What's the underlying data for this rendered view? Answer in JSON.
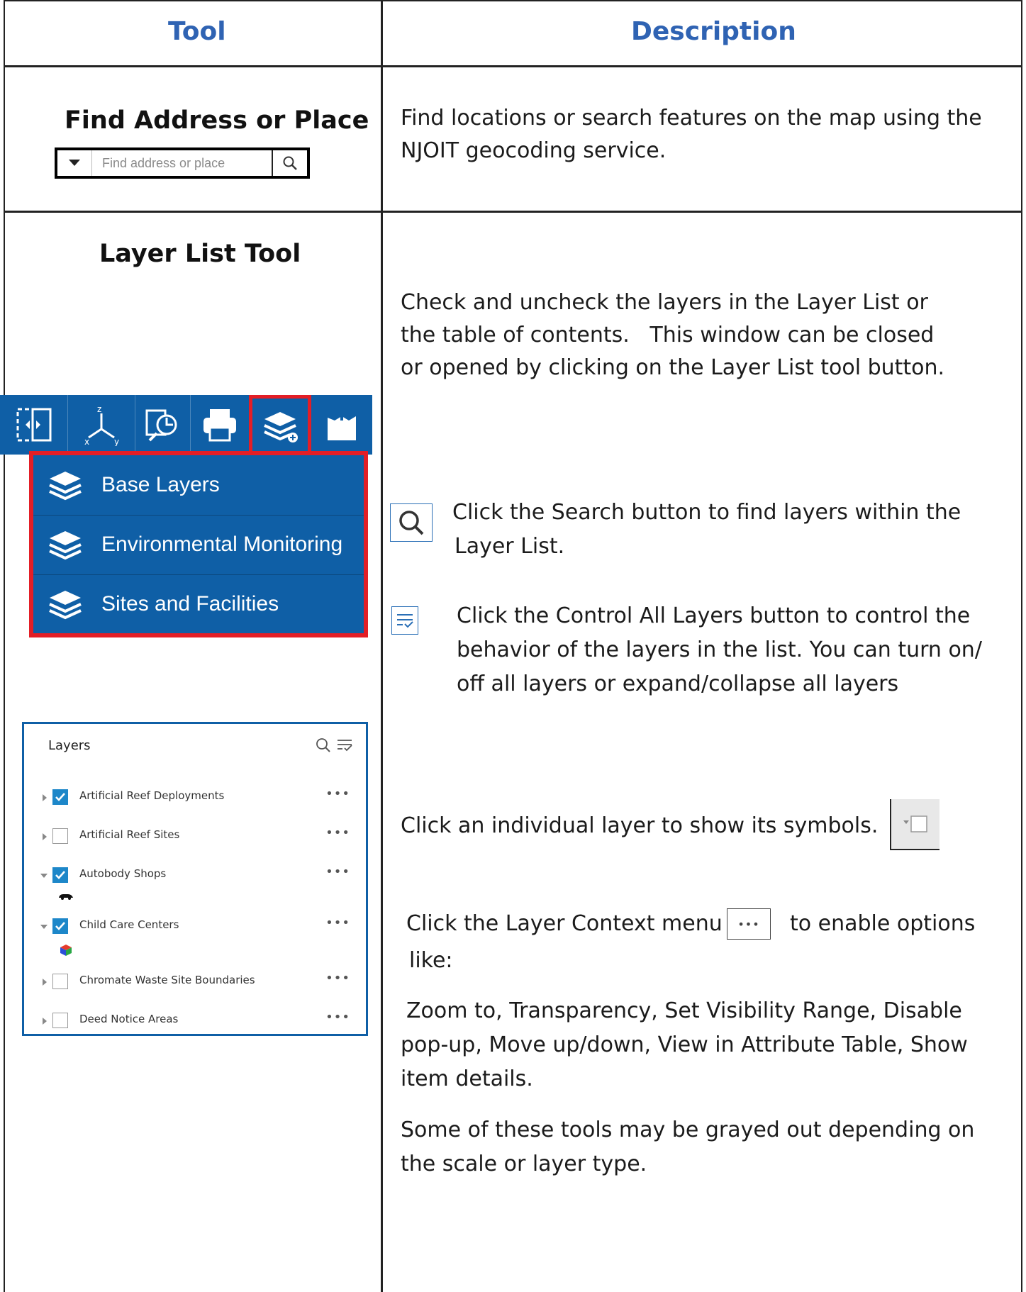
{
  "header": {
    "tool": "Tool",
    "description": "Description"
  },
  "find": {
    "title": "Find Address or Place",
    "placeholder": "Find address or place",
    "description": "Find locations or search features on the map using the NJOIT geocoding service."
  },
  "layerlist": {
    "title": "Layer List Tool",
    "intro": [
      "Check and uncheck the layers in the Layer List or",
      "the table of contents.   This window can be closed",
      "or opened by clicking on the Layer List tool button."
    ],
    "menu_items": [
      "Base Layers",
      "Environmental Monitoring",
      "Sites and Facilities"
    ],
    "search_text": [
      "Click the Search button  to find layers within the",
      "Layer List."
    ],
    "control_text": [
      "Click the Control All Layers button  to control the",
      "behavior of the layers in the list. You can turn on/",
      "off all layers or expand/collapse all layers"
    ],
    "individual_text": "Click an individual layer to show its symbols.",
    "context_text_a": "Click the Layer Context menu",
    "context_text_b": "to enable options",
    "context_text_c": "like:",
    "options_text": [
      "Zoom to, Transparency, Set Visibility Range, Disable",
      "pop-up, Move up/down, View in Attribute Table, Show",
      "item details."
    ],
    "grayed_text": [
      "Some of these tools may be grayed out depending on",
      "the scale or layer type."
    ]
  },
  "panel": {
    "title": "Layers",
    "rows": [
      {
        "name": "Artificial Reef Deployments",
        "checked": true,
        "expanded": false
      },
      {
        "name": "Artificial Reef Sites",
        "checked": false,
        "expanded": false
      },
      {
        "name": "Autobody Shops",
        "checked": true,
        "expanded": true
      },
      {
        "name": "Child Care Centers",
        "checked": true,
        "expanded": true
      },
      {
        "name": "Chromate Waste Site Boundaries",
        "checked": false,
        "expanded": false
      },
      {
        "name": "Deed Notice Areas",
        "checked": false,
        "expanded": false
      }
    ],
    "menu_glyph": "•••"
  },
  "colors": {
    "accent": "#2f63b3",
    "toolbar": "#0f5fa6",
    "highlight": "#e31e26",
    "check": "#1d87c9"
  }
}
